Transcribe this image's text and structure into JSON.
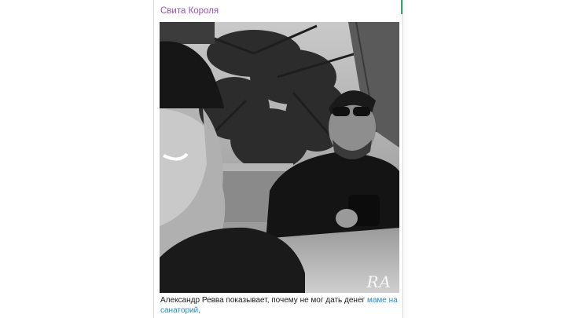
{
  "message": {
    "channel_name": "Свита Короля",
    "caption_text": "Александр Ревва показывает, почему не мог дать денег ",
    "caption_link": "маме на санаторий",
    "caption_end": ".",
    "watermark": "RA"
  },
  "colors": {
    "channel_name": "#9a4fc2",
    "link": "#1e8fd0",
    "accent": "#3fa36d"
  }
}
